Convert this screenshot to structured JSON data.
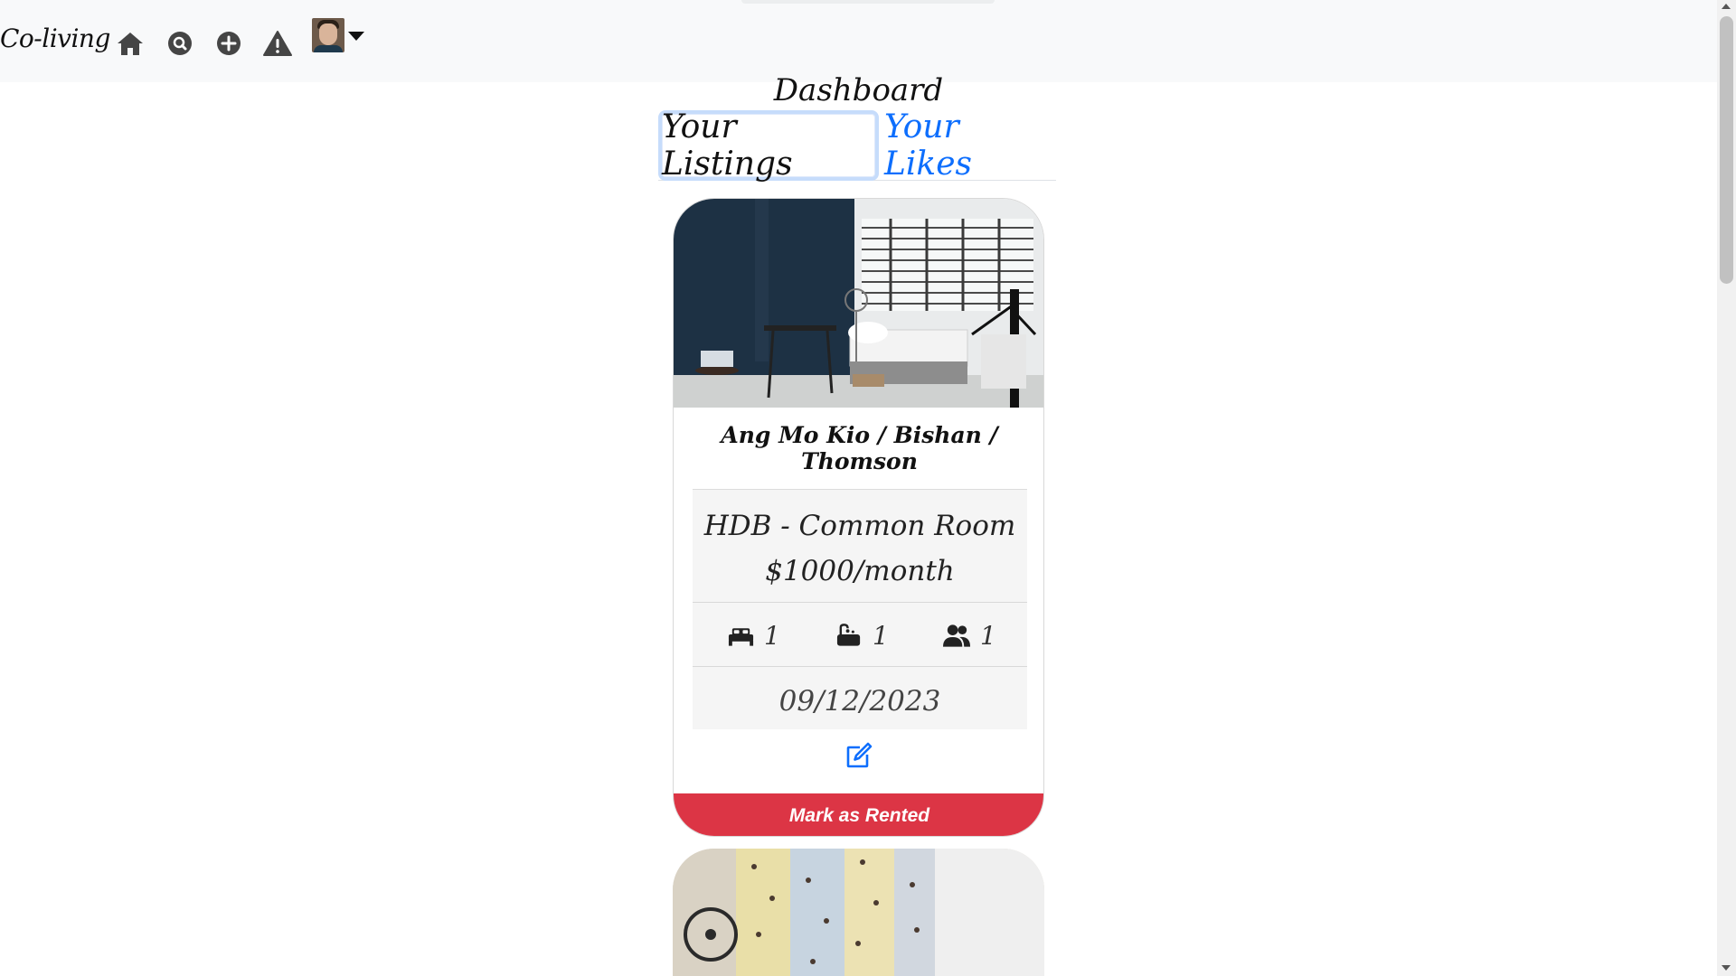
{
  "navbar": {
    "brand": "Co-living",
    "icons": [
      "home-icon",
      "search-icon",
      "add-icon",
      "warning-icon"
    ],
    "avatar_alt": "user avatar"
  },
  "dashboard": {
    "title": "Dashboard",
    "tabs": [
      {
        "label": "Your Listings",
        "active": true
      },
      {
        "label": "Your Likes",
        "active": false
      }
    ]
  },
  "listing": {
    "location": "Ang Mo Kio / Bishan / Thomson",
    "type": "HDB - Common Room",
    "price": "$1000/month",
    "bedrooms": "1",
    "bathrooms": "1",
    "occupants": "1",
    "date": "09/12/2023",
    "rent_button": "Mark as Rented"
  },
  "colors": {
    "accent": "#0d6efd",
    "danger": "#dc3545",
    "navbar_bg": "#f8f9fa"
  }
}
